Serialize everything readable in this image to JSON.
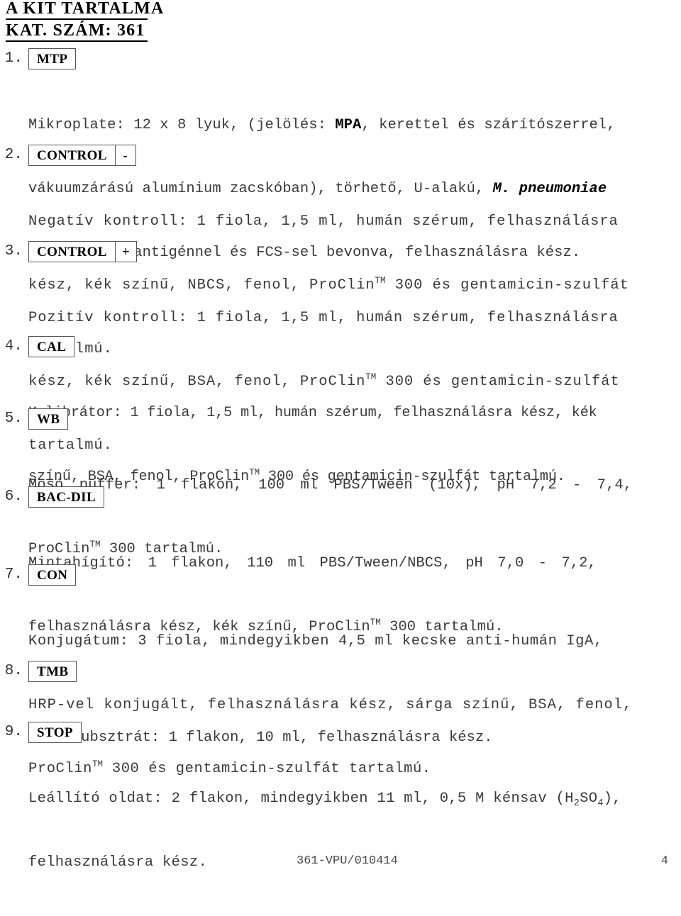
{
  "document": {
    "title_line_1": "A KIT TARTALMA",
    "title_line_2": "KAT. SZÁM: 361"
  },
  "items": [
    {
      "number": "1.",
      "tag_main": "MTP",
      "tag_sub": "",
      "lines": [
        "Mikroplate: 12 x 8 lyuk, (jelölés: MPA, kerettel és szárítószerrel,",
        "vákuumzárású alumínium zacskóban), törhető, U-alakú, M. pneumoniae",
        "rekombináns antigénnel és FCS-sel bevonva, felhasználásra kész."
      ]
    },
    {
      "number": "2.",
      "tag_main": "CONTROL",
      "tag_sub": "-",
      "lines": [
        "Negatív kontroll: 1 fiola, 1,5 ml, humán szérum, felhasználásra",
        "kész, kék színű, NBCS, fenol, ProClinTM 300 és gentamicin-szulfát",
        "tartalmú."
      ]
    },
    {
      "number": "3.",
      "tag_main": "CONTROL",
      "tag_sub": "+",
      "lines": [
        "Pozitív kontroll: 1 fiola, 1,5 ml, humán szérum, felhasználásra",
        "kész, kék színű, BSA, fenol, ProClinTM 300 és gentamicin-szulfát",
        "tartalmú."
      ]
    },
    {
      "number": "4.",
      "tag_main": "CAL",
      "tag_sub": "",
      "lines": [
        "Kalibrátor: 1 fiola, 1,5 ml, humán szérum, felhasználásra kész, kék",
        "színű, BSA, fenol, ProClinTM 300 és gentamicin-szulfát tartalmú."
      ]
    },
    {
      "number": "5.",
      "tag_main": "WB",
      "tag_sub": "",
      "lines": [
        "Mosó puffer: 1 flakon, 100 ml PBS/Tween (10x), pH 7,2 - 7,4,",
        "ProClinTM 300 tartalmú."
      ]
    },
    {
      "number": "6.",
      "tag_main": "BAC-DIL",
      "tag_sub": "",
      "lines": [
        "Mintahígító: 1 flakon, 110 ml PBS/Tween/NBCS, pH 7,0 - 7,2,",
        "felhasználásra kész, kék színű, ProClinTM 300 tartalmú."
      ]
    },
    {
      "number": "7.",
      "tag_main": "CON",
      "tag_sub": "",
      "lines": [
        "Konjugátum: 3 fiola, mindegyikben 4,5 ml kecske anti-humán IgA,",
        "HRP-vel konjugált, felhasználásra kész, sárga színű, BSA, fenol,",
        "ProClinTM 300 és gentamicin-szulfát tartalmú."
      ]
    },
    {
      "number": "8.",
      "tag_main": "TMB",
      "tag_sub": "",
      "lines": [
        "TMB szubsztrát: 1 flakon, 10 ml, felhasználásra kész."
      ]
    },
    {
      "number": "9.",
      "tag_main": "STOP",
      "tag_sub": "",
      "lines": [
        "Leállító oldat: 2 flakon, mindegyikben 11 ml, 0,5 M kénsav (H2SO4),",
        "felhasználásra kész."
      ]
    }
  ],
  "footer": {
    "code": "361-VPU/010414",
    "page_number": "4"
  }
}
